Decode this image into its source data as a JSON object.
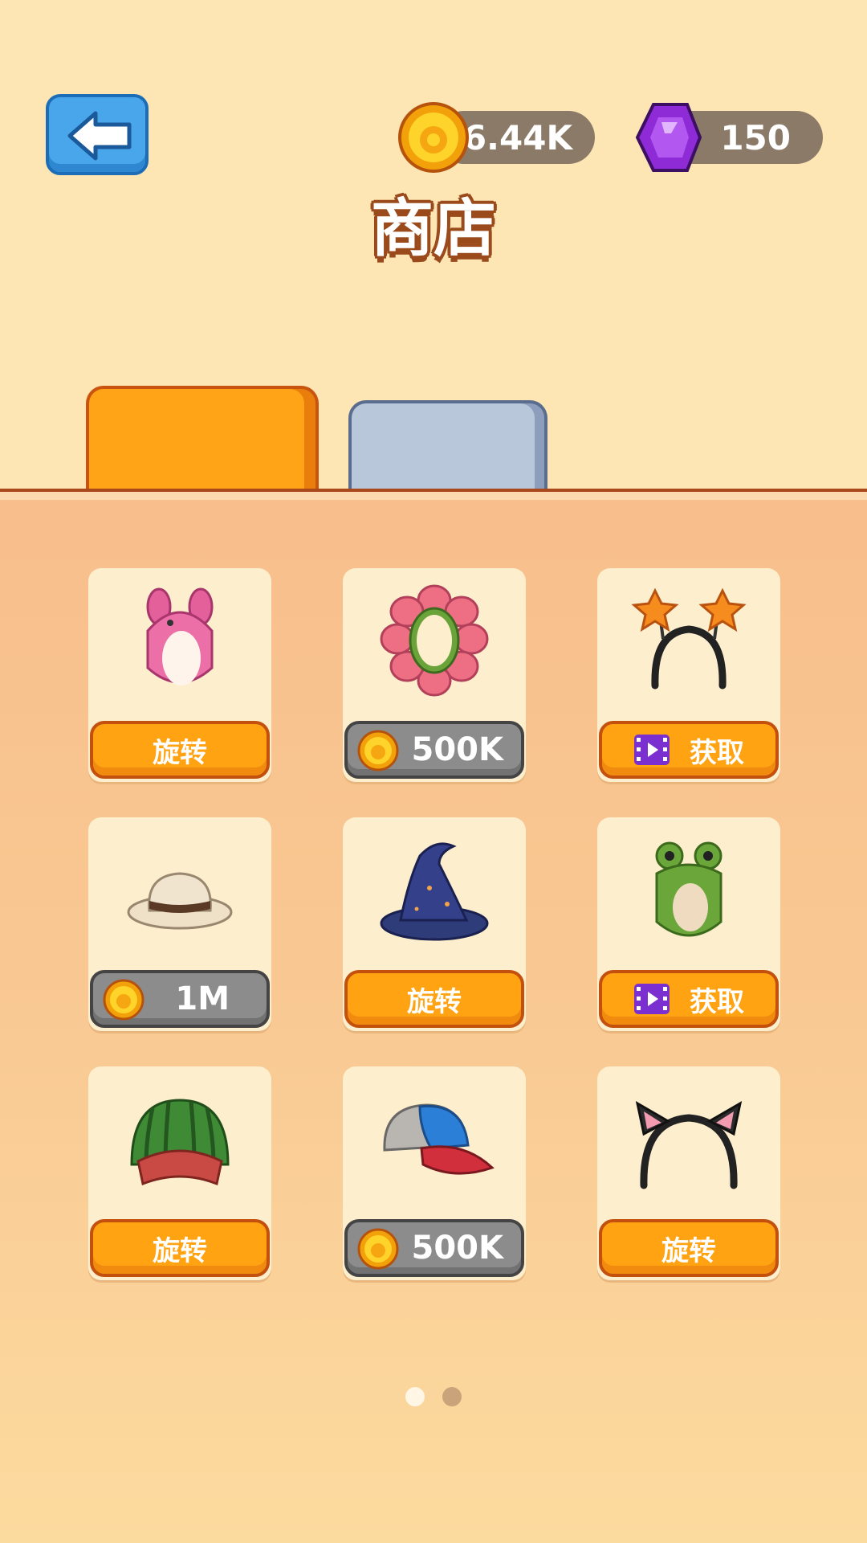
{
  "header": {
    "title": "商店",
    "coins": "6.44K",
    "gems": "150"
  },
  "tabs": [
    {
      "state": "active",
      "color": "#ffa416"
    },
    {
      "state": "inactive",
      "color": "#b9c7da"
    }
  ],
  "items": [
    {
      "icon": "pink-bunny-hood-icon",
      "button": {
        "type": "action",
        "label": "旋转"
      }
    },
    {
      "icon": "flower-headband-icon",
      "button": {
        "type": "price",
        "label": "500K"
      }
    },
    {
      "icon": "star-headband-icon",
      "button": {
        "type": "video",
        "label": "获取"
      }
    },
    {
      "icon": "fedora-hat-icon",
      "button": {
        "type": "price",
        "label": "1M"
      }
    },
    {
      "icon": "wizard-hat-icon",
      "button": {
        "type": "action",
        "label": "旋转"
      }
    },
    {
      "icon": "frog-hood-icon",
      "button": {
        "type": "video",
        "label": "获取"
      }
    },
    {
      "icon": "watermelon-helmet-icon",
      "button": {
        "type": "action",
        "label": "旋转"
      }
    },
    {
      "icon": "baseball-cap-icon",
      "button": {
        "type": "price",
        "label": "500K"
      }
    },
    {
      "icon": "cat-ear-headband-icon",
      "button": {
        "type": "action",
        "label": "旋转"
      }
    }
  ],
  "pagination": {
    "pages": 2,
    "current": 1
  },
  "colors": {
    "accent": "#ffa313",
    "background": "#fde6b3",
    "button_gray": "#8c8c8c",
    "gem": "#8e2bd6",
    "coin": "#f6b40d"
  }
}
